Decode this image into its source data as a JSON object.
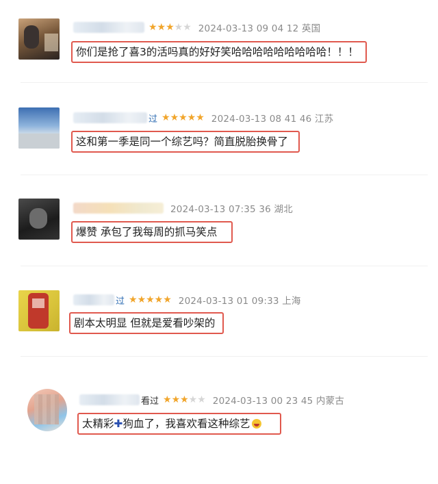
{
  "reviews": [
    {
      "name_suffix": "",
      "rating": 3,
      "timestamp": "2024-03-13 09 04 12 英国",
      "comment": "你们是抢了喜3的活吗真的好好笑哈哈哈哈哈哈哈哈哈！！！"
    },
    {
      "name_suffix": "过",
      "rating": 5,
      "timestamp": "2024-03-13 08 41 46 江苏",
      "comment": "这和第一季是同一个综艺吗？简直脱胎换骨了"
    },
    {
      "name_suffix": "",
      "rating": 0,
      "timestamp": "2024-03-13 07:35 36 湖北",
      "comment": "爆赞 承包了我每周的抓马笑点"
    },
    {
      "name_suffix": "过",
      "rating": 5,
      "timestamp": "2024-03-13 01 09:33 上海",
      "comment": "剧本太明显 但就是爱看吵架的"
    },
    {
      "name_suffix": "看过",
      "rating": 3,
      "timestamp": "2024-03-13 00 23 45 内蒙古",
      "comment_part1": "太精彩",
      "comment_plus": "✚",
      "comment_part2": "狗血了，我喜欢看这种综艺",
      "comment_emoji": "laughing-emoji"
    }
  ],
  "colors": {
    "star": "#f1a52b",
    "star_off": "#d6d6d6",
    "highlight_border": "#e0584d",
    "meta_text": "#8a8a8a"
  }
}
